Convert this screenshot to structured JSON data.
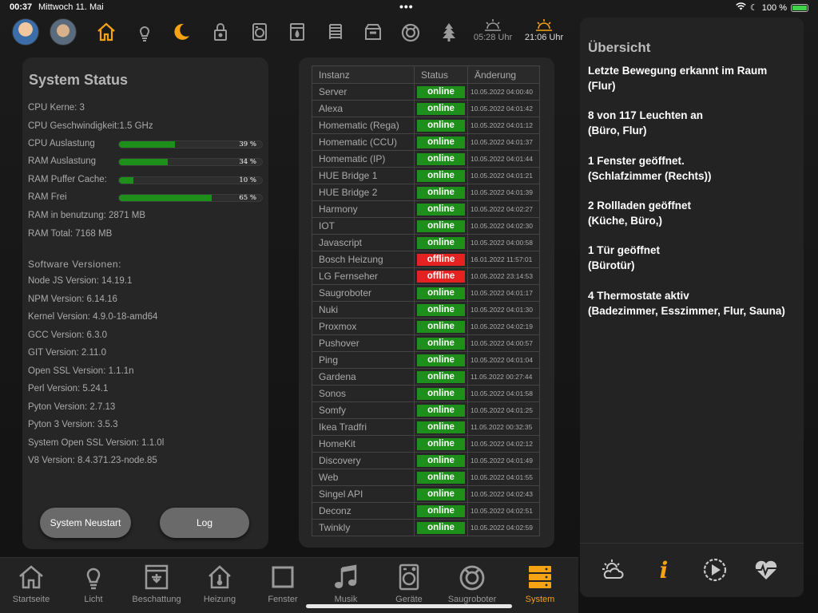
{
  "statusbar": {
    "time": "00:37",
    "date": "Mittwoch 11. Mai",
    "battery": "100 %"
  },
  "topnav": {
    "icons": [
      "home-icon",
      "bulb-icon",
      "moon-icon",
      "lock-icon",
      "washer-icon",
      "dryer-icon",
      "radiator-icon",
      "mailbox-icon",
      "robot-vacuum-icon",
      "tree-icon"
    ],
    "sunrise": "05:28 Uhr",
    "sunset": "21:06 Uhr"
  },
  "system": {
    "title": "System Status",
    "cpu_cores": "CPU Kerne: 3",
    "cpu_speed": "CPU Geschwindigkeit:1.5 GHz",
    "bars": [
      {
        "label": "CPU Auslastung",
        "pct": "39 %",
        "value": 0.39
      },
      {
        "label": "RAM Auslastung",
        "pct": "34 %",
        "value": 0.34
      },
      {
        "label": "RAM Puffer Cache:",
        "pct": "10 %",
        "value": 0.1
      },
      {
        "label": "RAM Frei",
        "pct": "65 %",
        "value": 0.65
      }
    ],
    "ram_used": "RAM in benutzung: 2871 MB",
    "ram_total": "RAM Total: 7168 MB",
    "software_header": "Software Versionen:",
    "versions": [
      "Node JS Version: 14.19.1",
      "NPM Version: 6.14.16",
      "Kernel Version: 4.9.0-18-amd64",
      "GCC Version: 6.3.0",
      "GIT Version: 2.11.0",
      "Open SSL Version: 1.1.1n",
      "Perl Version: 5.24.1",
      "Pyton Version: 2.7.13",
      "Pyton 3 Version: 3.5.3",
      "System Open SSL Version: 1.1.0l",
      "V8 Version: 8.4.371.23-node.85"
    ],
    "restart_button": "System Neustart",
    "log_button": "Log"
  },
  "instances": {
    "headers": {
      "name": "Instanz",
      "status": "Status",
      "changed": "Änderung"
    },
    "rows": [
      {
        "name": "Server",
        "status": "online",
        "changed": "10.05.2022 04:00:40"
      },
      {
        "name": "Alexa",
        "status": "online",
        "changed": "10.05.2022 04:01:42"
      },
      {
        "name": "Homematic (Rega)",
        "status": "online",
        "changed": "10.05.2022 04:01:12"
      },
      {
        "name": "Homematic (CCU)",
        "status": "online",
        "changed": "10.05.2022 04:01:37"
      },
      {
        "name": "Homematic (IP)",
        "status": "online",
        "changed": "10.05.2022 04:01:44"
      },
      {
        "name": "HUE Bridge 1",
        "status": "online",
        "changed": "10.05.2022 04:01:21"
      },
      {
        "name": "HUE Bridge 2",
        "status": "online",
        "changed": "10.05.2022 04:01:39"
      },
      {
        "name": "Harmony",
        "status": "online",
        "changed": "10.05.2022 04:02:27"
      },
      {
        "name": "IOT",
        "status": "online",
        "changed": "10.05.2022 04:02:30"
      },
      {
        "name": "Javascript",
        "status": "online",
        "changed": "10.05.2022 04:00:58"
      },
      {
        "name": "Bosch Heizung",
        "status": "offline",
        "changed": "16.01.2022 11:57:01"
      },
      {
        "name": "LG Fernseher",
        "status": "offline",
        "changed": "10.05.2022 23:14:53"
      },
      {
        "name": "Saugroboter",
        "status": "online",
        "changed": "10.05.2022 04:01:17"
      },
      {
        "name": "Nuki",
        "status": "online",
        "changed": "10.05.2022 04:01:30"
      },
      {
        "name": "Proxmox",
        "status": "online",
        "changed": "10.05.2022 04:02:19"
      },
      {
        "name": "Pushover",
        "status": "online",
        "changed": "10.05.2022 04:00:57"
      },
      {
        "name": "Ping",
        "status": "online",
        "changed": "10.05.2022 04:01:04"
      },
      {
        "name": "Gardena",
        "status": "online",
        "changed": "11.05.2022 00:27:44"
      },
      {
        "name": "Sonos",
        "status": "online",
        "changed": "10.05.2022 04:01:58"
      },
      {
        "name": "Somfy",
        "status": "online",
        "changed": "10.05.2022 04:01:25"
      },
      {
        "name": "Ikea Tradfri",
        "status": "online",
        "changed": "11.05.2022 00:32:35"
      },
      {
        "name": "HomeKit",
        "status": "online",
        "changed": "10.05.2022 04:02:12"
      },
      {
        "name": "Discovery",
        "status": "online",
        "changed": "10.05.2022 04:01:49"
      },
      {
        "name": "Web",
        "status": "online",
        "changed": "10.05.2022 04:01:55"
      },
      {
        "name": "Singel API",
        "status": "online",
        "changed": "10.05.2022 04:02:43"
      },
      {
        "name": "Deconz",
        "status": "online",
        "changed": "10.05.2022 04:02:51"
      },
      {
        "name": "Twinkly",
        "status": "online",
        "changed": "10.05.2022 04:02:59"
      }
    ]
  },
  "overview": {
    "title": "Übersicht",
    "items": [
      {
        "line1": "Letzte Bewegung erkannt im Raum",
        "line2": "(Flur)"
      },
      {
        "line1": "8 von 117 Leuchten an",
        "line2": "(Büro, Flur)"
      },
      {
        "line1": "1 Fenster geöffnet.",
        "line2": "(Schlafzimmer (Rechts))"
      },
      {
        "line1": "2 Rollladen geöffnet",
        "line2": "(Küche, Büro,)"
      },
      {
        "line1": "1 Tür geöffnet",
        "line2": "(Bürotür)"
      },
      {
        "line1": "4 Thermostate aktiv",
        "line2": "(Badezimmer, Esszimmer, Flur, Sauna)"
      }
    ],
    "footer_icons": [
      "weather-icon",
      "info-icon",
      "play-history-icon",
      "heartbeat-icon"
    ]
  },
  "bottomnav": [
    {
      "label": "Startseite",
      "icon": "home-icon"
    },
    {
      "label": "Licht",
      "icon": "bulb-icon"
    },
    {
      "label": "Beschattung",
      "icon": "shutter-icon"
    },
    {
      "label": "Heizung",
      "icon": "heating-icon"
    },
    {
      "label": "Fenster",
      "icon": "window-icon"
    },
    {
      "label": "Musik",
      "icon": "music-icon"
    },
    {
      "label": "Geräte",
      "icon": "washer-icon"
    },
    {
      "label": "Saugroboter",
      "icon": "robot-vacuum-icon"
    },
    {
      "label": "System",
      "icon": "server-icon",
      "active": true
    }
  ],
  "colors": {
    "accent": "#f5a313",
    "online": "#1e8f1a",
    "offline": "#e52222"
  }
}
